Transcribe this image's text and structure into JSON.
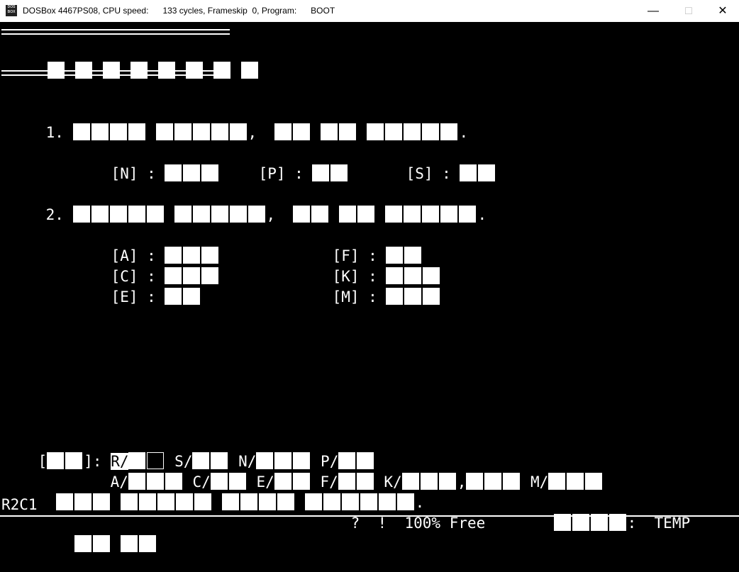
{
  "window": {
    "title": "DOSBox 4467PS08, CPU speed:      133 cycles, Frameskip  0, Program:      BOOT",
    "icon_text": "DOS BOX",
    "minimize_icon": "minimize-icon",
    "maximize_icon": "maximize-icon",
    "close_icon": "close-icon"
  },
  "header": {
    "box_count": 8
  },
  "menu1": {
    "number": "1.",
    "punctuation_comma": ",",
    "punctuation_period": ".",
    "options": [
      {
        "key": "[N]",
        "sep": ":"
      },
      {
        "key": "[P]",
        "sep": ":"
      },
      {
        "key": "[S]",
        "sep": ":"
      }
    ]
  },
  "menu2": {
    "number": "2.",
    "punctuation_comma": ",",
    "punctuation_period": ".",
    "options_left": [
      {
        "key": "[A]",
        "sep": ":"
      },
      {
        "key": "[C]",
        "sep": ":"
      },
      {
        "key": "[E]",
        "sep": ":"
      }
    ],
    "options_right": [
      {
        "key": "[F]",
        "sep": ":"
      },
      {
        "key": "[K]",
        "sep": ":"
      },
      {
        "key": "[M]",
        "sep": ":"
      }
    ]
  },
  "prompt": {
    "open": "[",
    "close": "]:",
    "r_label": "R/",
    "s_label": "S/",
    "n_label": "N/",
    "p_label": "P/",
    "a_label": "A/",
    "c_label": "C/",
    "e_label": "E/",
    "f_label": "F/",
    "k_label": "K/",
    "comma": ",",
    "m_label": "M/",
    "period": "."
  },
  "status": {
    "position": "R2C1",
    "q": "?",
    "bang": "!",
    "free": "100% Free",
    "colon": ":",
    "mode": "TEMP"
  }
}
